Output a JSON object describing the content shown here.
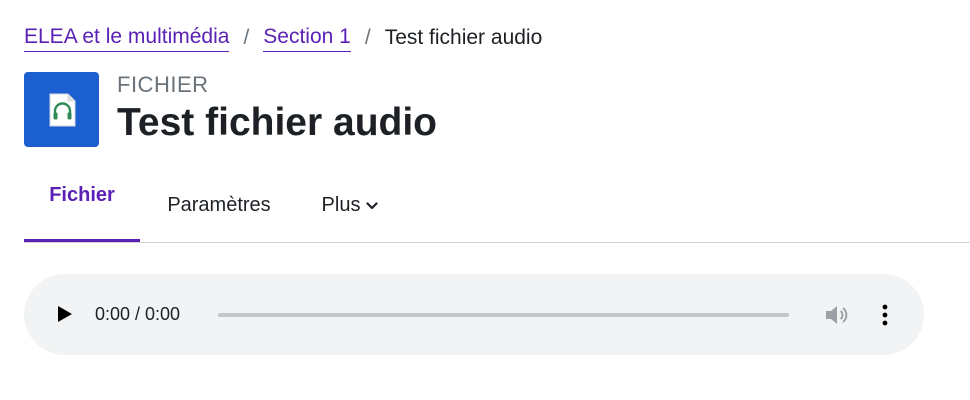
{
  "breadcrumb": {
    "items": [
      {
        "label": "ELEA et le multimédia"
      },
      {
        "label": "Section 1"
      }
    ],
    "separator": "/",
    "current": "Test fichier audio"
  },
  "header": {
    "module_type": "FICHIER",
    "title": "Test fichier audio",
    "icon": "audio-file-icon",
    "icon_color": "#1b5fd1"
  },
  "tabs": [
    {
      "label": "Fichier",
      "active": true
    },
    {
      "label": "Paramètres",
      "active": false
    },
    {
      "label": "Plus",
      "active": false,
      "icon": "chevron-down-icon"
    }
  ],
  "audio_player": {
    "time": "0:00 / 0:00",
    "progress": 0,
    "play_icon": "play-icon",
    "volume_icon": "volume-icon",
    "menu_icon": "more-vertical-icon"
  },
  "colors": {
    "accent": "#5b21b6",
    "text": "#1d2125",
    "muted": "#6a737b",
    "player_bg": "#f1f3f4"
  }
}
